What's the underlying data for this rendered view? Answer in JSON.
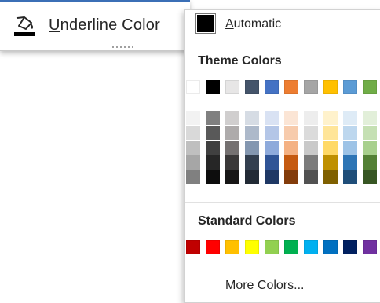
{
  "menu_item": {
    "underline_letter": "U",
    "label_rest": "nderline Color",
    "icon": "underline-color-paint-bucket-icon"
  },
  "automatic": {
    "underline_letter": "A",
    "label_rest": "utomatic",
    "swatch_color": "#000000"
  },
  "theme": {
    "title": "Theme Colors",
    "base": [
      "#FFFFFF",
      "#000000",
      "#E7E6E6",
      "#44546A",
      "#4472C4",
      "#ED7D31",
      "#A5A5A5",
      "#FFC000",
      "#5B9BD5",
      "#70AD47"
    ],
    "shades": [
      [
        "#F2F2F2",
        "#D9D9D9",
        "#BFBFBF",
        "#A6A6A6",
        "#808080"
      ],
      [
        "#808080",
        "#595959",
        "#404040",
        "#262626",
        "#0D0D0D"
      ],
      [
        "#D0CECE",
        "#AEABAB",
        "#757171",
        "#3A3838",
        "#171616"
      ],
      [
        "#D6DCE4",
        "#ADB9CA",
        "#8497B0",
        "#333F4F",
        "#222A35"
      ],
      [
        "#D9E2F3",
        "#B4C6E7",
        "#8EAADB",
        "#2F5496",
        "#1F3864"
      ],
      [
        "#FBE5D5",
        "#F7CBAC",
        "#F4B183",
        "#C55A11",
        "#833C0B"
      ],
      [
        "#EDEDED",
        "#DBDBDB",
        "#C9C9C9",
        "#7B7B7B",
        "#525252"
      ],
      [
        "#FFF2CC",
        "#FFE599",
        "#FFD966",
        "#BF9000",
        "#7F6000"
      ],
      [
        "#DEEBF6",
        "#BDD7EE",
        "#9DC3E6",
        "#2E75B5",
        "#1F4E79"
      ],
      [
        "#E2EFD9",
        "#C5E0B3",
        "#A8D08D",
        "#538135",
        "#375623"
      ]
    ]
  },
  "standard": {
    "title": "Standard Colors",
    "colors": [
      "#C00000",
      "#FF0000",
      "#FFC000",
      "#FFFF00",
      "#92D050",
      "#00B050",
      "#00B0F0",
      "#0070C0",
      "#002060",
      "#7030A0"
    ]
  },
  "more_colors": {
    "underline_letter": "M",
    "label_rest": "ore Colors..."
  }
}
